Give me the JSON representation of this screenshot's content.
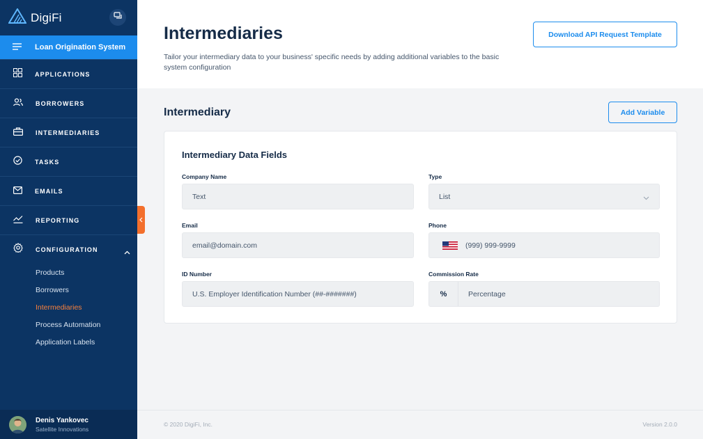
{
  "sidebar": {
    "brand": "DigiFi",
    "product": "Loan Origination System",
    "nav": [
      {
        "label": "APPLICATIONS",
        "icon": "grid-icon"
      },
      {
        "label": "BORROWERS",
        "icon": "users-icon"
      },
      {
        "label": "INTERMEDIARIES",
        "icon": "briefcase-icon"
      },
      {
        "label": "TASKS",
        "icon": "check-circle-icon"
      },
      {
        "label": "EMAILS",
        "icon": "mail-icon"
      },
      {
        "label": "REPORTING",
        "icon": "trend-icon"
      },
      {
        "label": "CONFIGURATION",
        "icon": "gear-icon"
      }
    ],
    "sub_items": [
      "Products",
      "Borrowers",
      "Intermediaries",
      "Process Automation",
      "Application Labels"
    ],
    "active_sub": "Intermediaries",
    "user": {
      "name": "Denis Yankovec",
      "org": "Satellite Innovations"
    }
  },
  "header": {
    "title": "Intermediaries",
    "description": "Tailor your intermediary data to your business' specific needs by adding additional variables to the basic system configuration",
    "download_button": "Download API Request Template"
  },
  "section": {
    "title": "Intermediary",
    "add_button": "Add Variable"
  },
  "card": {
    "title": "Intermediary Data Fields",
    "fields": {
      "company_name": {
        "label": "Company Name",
        "value": "Text"
      },
      "type": {
        "label": "Type",
        "value": "List"
      },
      "email": {
        "label": "Email",
        "value": "email@domain.com"
      },
      "phone": {
        "label": "Phone",
        "value": "(999) 999-9999"
      },
      "id_number": {
        "label": "ID Number",
        "value": "U.S. Employer Identification Number (##-#######)"
      },
      "commission_rate": {
        "label": "Commission Rate",
        "prefix": "%",
        "value": "Percentage"
      }
    }
  },
  "footer": {
    "copyright": "© 2020 DigiFi, Inc.",
    "version": "Version 2.0.0"
  },
  "colors": {
    "sidebar_bg": "#0c3463",
    "accent_blue": "#1c8ced",
    "accent_orange": "#f36f2c"
  }
}
